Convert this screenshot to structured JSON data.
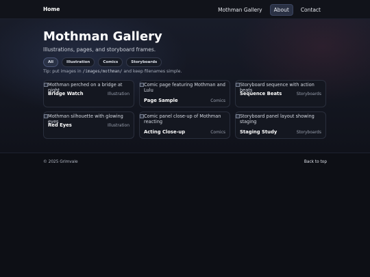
{
  "nav": {
    "brand": "Home",
    "items": [
      {
        "label": "Mothman Gallery",
        "active": false
      },
      {
        "label": "About",
        "active": true
      },
      {
        "label": "Contact",
        "active": false
      }
    ]
  },
  "hero": {
    "title": "Mothman Gallery",
    "subtitle": "Illustrations, pages, and storyboard frames.",
    "filters": [
      "All",
      "Illustration",
      "Comics",
      "Storyboards"
    ],
    "active_filter": "All",
    "tip_prefix": "Tip: put images in",
    "tip_path": "/images/mothman/",
    "tip_suffix": "and keep filenames simple."
  },
  "cards": [
    {
      "alt": "Mothman perched on a bridge at night",
      "name": "Bridge Watch",
      "category": "Illustration"
    },
    {
      "alt": "Comic page featuring Mothman and Lulu",
      "name": "Page Sample",
      "category": "Comics"
    },
    {
      "alt": "Storyboard sequence with action beats",
      "name": "Sequence Beats",
      "category": "Storyboards"
    },
    {
      "alt": "Mothman silhouette with glowing eyes",
      "name": "Red Eyes",
      "category": "Illustration"
    },
    {
      "alt": "Comic panel close-up of Mothman reacting",
      "name": "Acting Close-up",
      "category": "Comics"
    },
    {
      "alt": "Storyboard panel layout showing staging",
      "name": "Staging Study",
      "category": "Storyboards"
    }
  ],
  "footer": {
    "copyright": "© 2025 Grimvale",
    "back_to_top": "Back to top"
  }
}
